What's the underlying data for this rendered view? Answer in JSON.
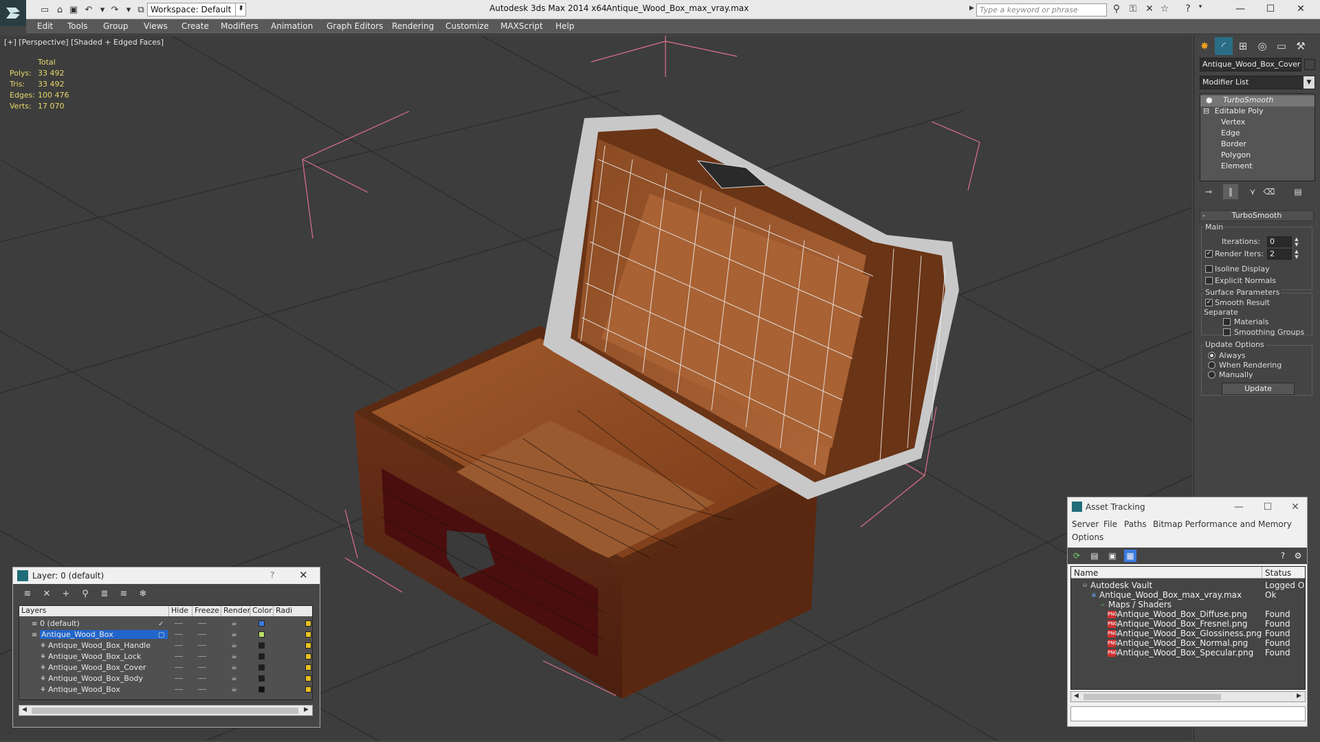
{
  "titlebar": {
    "app_title": "Autodesk 3ds Max  2014 x64",
    "file_title": "Antique_Wood_Box_max_vray.max",
    "workspace_label": "Workspace: Default",
    "search_placeholder": "Type a keyword or phrase",
    "window_controls": [
      "minimize",
      "maximize",
      "close"
    ]
  },
  "menubar": {
    "items": [
      "Edit",
      "Tools",
      "Group",
      "Views",
      "Create",
      "Modifiers",
      "Animation",
      "Graph Editors",
      "Rendering",
      "Customize",
      "MAXScript",
      "Help"
    ]
  },
  "viewport": {
    "label": "[+] [Perspective] [Shaded + Edged Faces]",
    "stats": {
      "header": "Total",
      "rows": [
        {
          "key": "Polys:",
          "value": "33 492"
        },
        {
          "key": "Tris:",
          "value": "33 492"
        },
        {
          "key": "Edges:",
          "value": "100 476"
        },
        {
          "key": "Verts:",
          "value": "17 070"
        }
      ]
    }
  },
  "command_panel": {
    "object_name": "Antique_Wood_Box_Cover",
    "modifier_list": "Modifier List",
    "stack": [
      "TurboSmooth",
      "Editable Poly",
      "Vertex",
      "Edge",
      "Border",
      "Polygon",
      "Element"
    ],
    "rollout_title": "TurboSmooth",
    "main": {
      "group": "Main",
      "iterations_label": "Iterations:",
      "iterations_value": "0",
      "render_iters_label": "Render Iters:",
      "render_iters_value": "2",
      "render_iters_checked": true,
      "isoline_label": "Isoline Display",
      "explicit_label": "Explicit Normals"
    },
    "surface": {
      "group": "Surface Parameters",
      "smooth_result": "Smooth Result",
      "separate": "Separate",
      "materials": "Materials",
      "smoothing_groups": "Smoothing Groups"
    },
    "update": {
      "group": "Update Options",
      "always": "Always",
      "when_rendering": "When Rendering",
      "manually": "Manually",
      "button": "Update"
    }
  },
  "layer_window": {
    "title": "Layer: 0 (default)",
    "help": "?",
    "columns": [
      "Layers",
      "Hide",
      "Freeze",
      "Render",
      "Color",
      "Radi"
    ],
    "rows": [
      {
        "name": "0 (default)",
        "indent": 0,
        "color": "#3a7be0",
        "checked": true
      },
      {
        "name": "Antique_Wood_Box",
        "indent": 0,
        "color": "#b8e06a",
        "selected": true
      },
      {
        "name": "Antique_Wood_Box_Handle",
        "indent": 1,
        "color": "#1e1e1e"
      },
      {
        "name": "Antique_Wood_Box_Lock",
        "indent": 1,
        "color": "#1e1e1e"
      },
      {
        "name": "Antique_Wood_Box_Cover",
        "indent": 1,
        "color": "#1e1e1e"
      },
      {
        "name": "Antique_Wood_Box_Body",
        "indent": 1,
        "color": "#1e1e1e"
      },
      {
        "name": "Antique_Wood_Box",
        "indent": 1,
        "color": "#111111"
      }
    ]
  },
  "asset_tracking": {
    "title": "Asset Tracking",
    "menu": [
      "Server",
      "File",
      "Paths",
      "Bitmap Performance and Memory",
      "Options"
    ],
    "columns": [
      "Name",
      "Status"
    ],
    "rows": [
      {
        "name": "Autodesk Vault",
        "status": "Logged Out",
        "indent": 0,
        "icon": "vault-icon"
      },
      {
        "name": "Antique_Wood_Box_max_vray.max",
        "status": "Ok",
        "indent": 1,
        "icon": "max-file-icon"
      },
      {
        "name": "Maps / Shaders",
        "status": "",
        "indent": 2,
        "icon": "maps-icon"
      },
      {
        "name": "Antique_Wood_Box_Diffuse.png",
        "status": "Found",
        "indent": 3,
        "icon": "png-icon"
      },
      {
        "name": "Antique_Wood_Box_Fresnel.png",
        "status": "Found",
        "indent": 3,
        "icon": "png-icon"
      },
      {
        "name": "Antique_Wood_Box_Glossiness.png",
        "status": "Found",
        "indent": 3,
        "icon": "png-icon"
      },
      {
        "name": "Antique_Wood_Box_Normal.png",
        "status": "Found",
        "indent": 3,
        "icon": "png-icon"
      },
      {
        "name": "Antique_Wood_Box_Specular.png",
        "status": "Found",
        "indent": 3,
        "icon": "png-icon"
      }
    ]
  },
  "colors": {
    "stats_text": "#e8d86a",
    "selection_blue": "#2266cc",
    "bbox_pink": "#e0708a",
    "wood_dark": "#6b3418",
    "wood_light": "#a0582c"
  }
}
